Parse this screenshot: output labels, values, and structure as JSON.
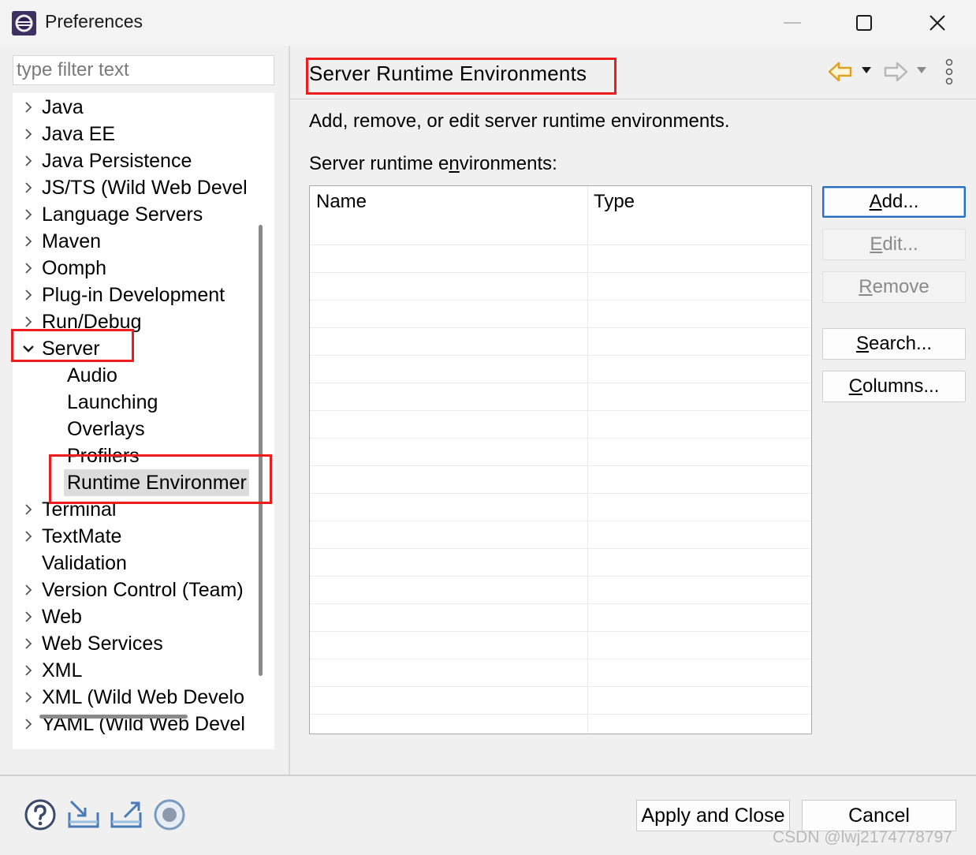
{
  "window": {
    "title": "Preferences",
    "app_icon": "eclipse-icon",
    "controls": [
      "minimize-icon",
      "maximize-icon",
      "close-icon"
    ]
  },
  "filter": {
    "placeholder": "type filter text",
    "value": ""
  },
  "tree": {
    "items": [
      {
        "label": "Java",
        "expandable": true,
        "expanded": false,
        "level": 0
      },
      {
        "label": "Java EE",
        "expandable": true,
        "expanded": false,
        "level": 0
      },
      {
        "label": "Java Persistence",
        "expandable": true,
        "expanded": false,
        "level": 0
      },
      {
        "label": "JS/TS (Wild Web Devel",
        "expandable": true,
        "expanded": false,
        "level": 0
      },
      {
        "label": "Language Servers",
        "expandable": true,
        "expanded": false,
        "level": 0
      },
      {
        "label": "Maven",
        "expandable": true,
        "expanded": false,
        "level": 0
      },
      {
        "label": "Oomph",
        "expandable": true,
        "expanded": false,
        "level": 0
      },
      {
        "label": "Plug-in Development",
        "expandable": true,
        "expanded": false,
        "level": 0
      },
      {
        "label": "Run/Debug",
        "expandable": true,
        "expanded": false,
        "level": 0
      },
      {
        "label": "Server",
        "expandable": true,
        "expanded": true,
        "level": 0
      },
      {
        "label": "Audio",
        "expandable": false,
        "level": 1
      },
      {
        "label": "Launching",
        "expandable": false,
        "level": 1
      },
      {
        "label": "Overlays",
        "expandable": false,
        "level": 1
      },
      {
        "label": "Profilers",
        "expandable": false,
        "level": 1
      },
      {
        "label": "Runtime Environmer",
        "expandable": false,
        "level": 1,
        "selected": true
      },
      {
        "label": "Terminal",
        "expandable": true,
        "expanded": false,
        "level": 0
      },
      {
        "label": "TextMate",
        "expandable": true,
        "expanded": false,
        "level": 0
      },
      {
        "label": "Validation",
        "expandable": false,
        "level": 0
      },
      {
        "label": "Version Control (Team)",
        "expandable": true,
        "expanded": false,
        "level": 0
      },
      {
        "label": "Web",
        "expandable": true,
        "expanded": false,
        "level": 0
      },
      {
        "label": "Web Services",
        "expandable": true,
        "expanded": false,
        "level": 0
      },
      {
        "label": "XML",
        "expandable": true,
        "expanded": false,
        "level": 0
      },
      {
        "label": "XML (Wild Web Develo",
        "expandable": true,
        "expanded": false,
        "level": 0
      },
      {
        "label": "YAML (Wild Web Devel",
        "expandable": true,
        "expanded": false,
        "level": 0
      }
    ]
  },
  "page": {
    "title": "Server Runtime Environments",
    "nav_icons": [
      "back-arrow-icon",
      "back-dropdown-icon",
      "forward-arrow-icon",
      "forward-dropdown-icon",
      "view-menu-icon"
    ],
    "description": "Add, remove, or edit server runtime environments.",
    "list_label": {
      "before": "Server runtime e",
      "mnemonic": "n",
      "after": "vironments:"
    },
    "table": {
      "columns": [
        "Name",
        "Type"
      ],
      "rows": []
    },
    "buttons": [
      {
        "id": "add",
        "mnemonic": "A",
        "rest": "dd...",
        "enabled": true,
        "default": true
      },
      {
        "id": "edit",
        "mnemonic": "E",
        "rest": "dit...",
        "enabled": false
      },
      {
        "id": "remove",
        "mnemonic": "R",
        "rest": "emove",
        "enabled": false
      },
      {
        "id": "search",
        "mnemonic": "S",
        "rest": "earch...",
        "enabled": true
      },
      {
        "id": "columns",
        "mnemonic": "C",
        "rest": "olumns...",
        "enabled": true
      }
    ]
  },
  "bottom": {
    "icons": [
      "help-icon",
      "import-icon",
      "export-icon",
      "record-icon"
    ],
    "apply_close": "Apply and Close",
    "cancel": "Cancel",
    "watermark": "CSDN @lwj2174778797"
  },
  "colors": {
    "highlight": "#ee1c1c",
    "accent": "#2a6ebd",
    "nav_arrow": "#e0a020"
  }
}
